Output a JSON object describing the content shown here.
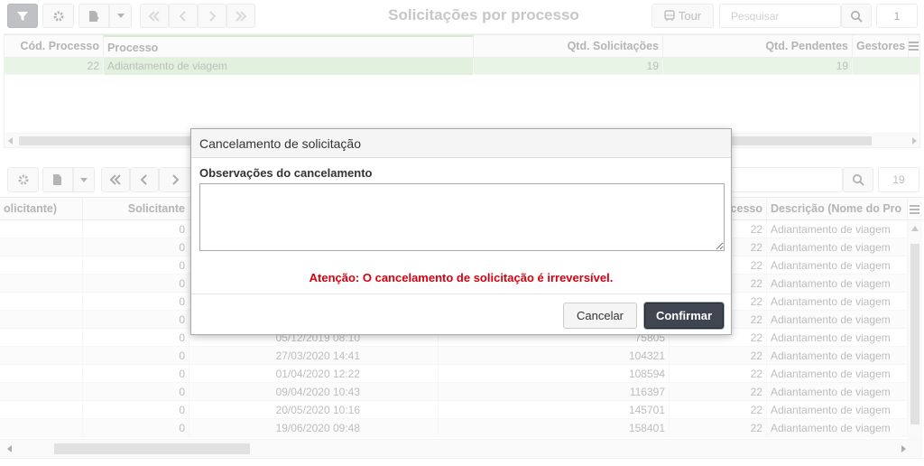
{
  "top_toolbar": {
    "title": "Solicitações por processo",
    "tour_label": "Tour",
    "search_placeholder": "Pesquisar",
    "page_number": "1"
  },
  "top_grid": {
    "columns": [
      "Cód. Processo",
      "Processo",
      "Qtd. Solicitações",
      "Qtd. Pendentes",
      "Gestores"
    ],
    "rows": [
      {
        "cod": "22",
        "processo": "Adiantamento de viagem",
        "qtd_sol": "19",
        "qtd_pend": "19"
      }
    ]
  },
  "bottom_toolbar": {
    "page_number": "19"
  },
  "bottom_grid": {
    "columns": [
      "olicitante)",
      "Solicitante",
      "",
      "",
      "ocesso",
      "Descrição (Nome do Pro"
    ],
    "rows": [
      {
        "sol": "0",
        "date": "",
        "num": "",
        "proc": "22",
        "desc": "Adiantamento de viagem"
      },
      {
        "sol": "0",
        "date": "",
        "num": "",
        "proc": "22",
        "desc": "Adiantamento de viagem"
      },
      {
        "sol": "0",
        "date": "",
        "num": "",
        "proc": "22",
        "desc": "Adiantamento de viagem"
      },
      {
        "sol": "0",
        "date": "",
        "num": "",
        "proc": "22",
        "desc": "Adiantamento de viagem"
      },
      {
        "sol": "0",
        "date": "",
        "num": "",
        "proc": "22",
        "desc": "Adiantamento de viagem"
      },
      {
        "sol": "0",
        "date": "",
        "num": "",
        "proc": "22",
        "desc": "Adiantamento de viagem"
      },
      {
        "sol": "0",
        "date": "05/12/2019 08:10",
        "num": "75805",
        "proc": "22",
        "desc": "Adiantamento de viagem"
      },
      {
        "sol": "0",
        "date": "27/03/2020 14:41",
        "num": "104321",
        "proc": "22",
        "desc": "Adiantamento de viagem"
      },
      {
        "sol": "0",
        "date": "01/04/2020 12:22",
        "num": "108594",
        "proc": "22",
        "desc": "Adiantamento de viagem"
      },
      {
        "sol": "0",
        "date": "09/04/2020 10:43",
        "num": "116397",
        "proc": "22",
        "desc": "Adiantamento de viagem"
      },
      {
        "sol": "0",
        "date": "20/05/2020 10:16",
        "num": "145701",
        "proc": "22",
        "desc": "Adiantamento de viagem"
      },
      {
        "sol": "0",
        "date": "19/06/2020 09:48",
        "num": "158401",
        "proc": "22",
        "desc": "Adiantamento de viagem"
      }
    ]
  },
  "modal": {
    "title": "Cancelamento de solicitação",
    "label": "Observações do cancelamento",
    "textarea_value": "",
    "warning": "Atenção: O cancelamento de solicitação é irreversível.",
    "cancel_label": "Cancelar",
    "confirm_label": "Confirmar"
  },
  "colors": {
    "selected_row": "#d6ecd2",
    "warning": "#d9000d",
    "confirm_bg": "#3f4652"
  }
}
